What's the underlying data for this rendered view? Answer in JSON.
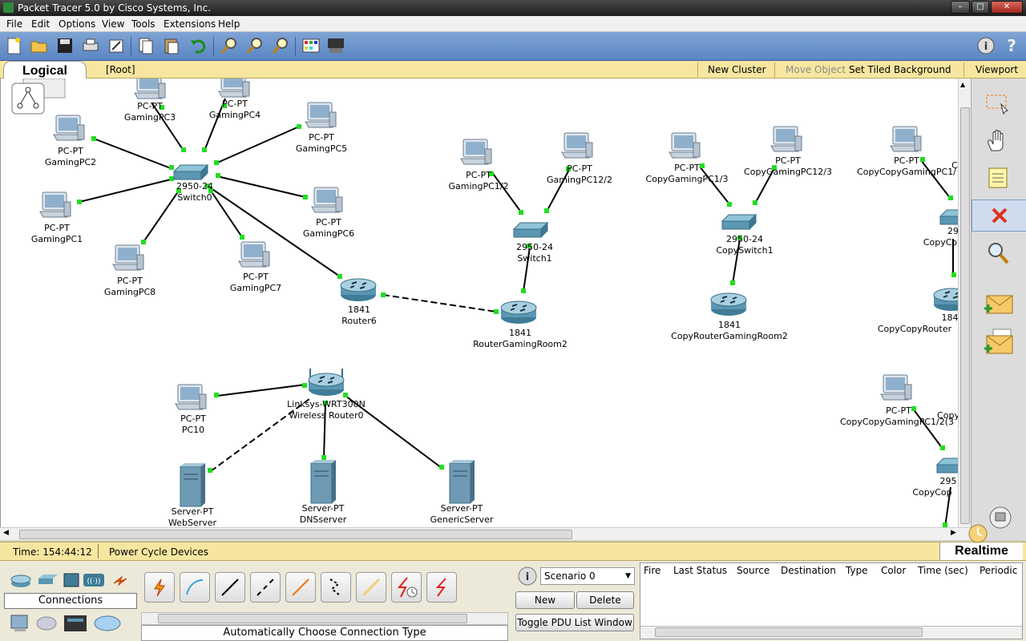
{
  "window": {
    "title": "Packet Tracer 5.0 by Cisco Systems, Inc."
  },
  "menu": [
    "File",
    "Edit",
    "Options",
    "View",
    "Tools",
    "Extensions",
    "Help"
  ],
  "toolbar_icons": [
    "new-icon",
    "open-icon",
    "save-icon",
    "print-icon",
    "wizard-icon",
    "copy-icon",
    "paste-icon",
    "undo-icon",
    "zoom-in-icon",
    "zoom-reset-icon",
    "zoom-out-icon",
    "palette-icon",
    "custom-device-icon"
  ],
  "viewbar": {
    "tab": "Logical",
    "root": "[Root]",
    "new_cluster": "New Cluster",
    "move_object": "Move Object",
    "tiled_bg": "Set Tiled Background",
    "viewport": "Viewport"
  },
  "devices": {
    "gpc3": [
      "PC-PT",
      "GamingPC3"
    ],
    "gpc4": [
      "PC-PT",
      "GamingPC4"
    ],
    "gpc2": [
      "PC-PT",
      "GamingPC2"
    ],
    "gpc5": [
      "PC-PT",
      "GamingPC5"
    ],
    "sw0": [
      "2950-24",
      "Switch0"
    ],
    "gpc1": [
      "PC-PT",
      "GamingPC1"
    ],
    "gpc6": [
      "PC-PT",
      "GamingPC6"
    ],
    "gpc8": [
      "PC-PT",
      "GamingPC8"
    ],
    "gpc7": [
      "PC-PT",
      "GamingPC7"
    ],
    "r6": [
      "1841",
      "Router6"
    ],
    "gpc12": [
      "PC-PT",
      "GamingPC1/2"
    ],
    "gpc122": [
      "PC-PT",
      "GamingPC12/2"
    ],
    "sw1": [
      "2950-24",
      "Switch1"
    ],
    "rgr2": [
      "1841",
      "RouterGamingRoom2"
    ],
    "cgpc13": [
      "PC-PT",
      "CopyGamingPC1/3"
    ],
    "cgpc123": [
      "PC-PT",
      "CopyGamingPC12/3"
    ],
    "csw1": [
      "2950-24",
      "CopySwitch1"
    ],
    "crgr2": [
      "1841",
      "CopyRouterGamingRoom2"
    ],
    "ccg1": [
      "PC-PT",
      "CopyCopyGamingPC1/"
    ],
    "ccsw": [
      "29",
      "CopyCo"
    ],
    "ccr": [
      "184",
      "CopyCopyRouter"
    ],
    "ccg2": [
      "PC-PT",
      "CopyCopyGamingPC1/2(3"
    ],
    "ccsw2": [
      "295",
      "CopyCop"
    ],
    "pc10": [
      "PC-PT",
      "PC10"
    ],
    "wr0": [
      "Linksys-WRT300N",
      "Wireless Router0"
    ],
    "web": [
      "Server-PT",
      "WebServer"
    ],
    "dns": [
      "Server-PT",
      "DNSserver"
    ],
    "gen": [
      "Server-PT",
      "GenericServer"
    ]
  },
  "edge_text": {
    "c1": "C",
    "c2": "Copy"
  },
  "status": {
    "time": "Time: 154:44:12",
    "power": "Power Cycle Devices",
    "mode": "Realtime"
  },
  "bottom": {
    "connections": "Connections",
    "auto_type": "Automatically Choose Connection Type",
    "scenario": "Scenario 0",
    "new": "New",
    "delete": "Delete",
    "toggle": "Toggle PDU List Window",
    "columns": [
      "Fire",
      "Last Status",
      "Source",
      "Destination",
      "Type",
      "Color",
      "Time (sec)",
      "Periodic"
    ]
  },
  "colors": {
    "toolbar": "#5a86c4",
    "yellowbar": "#f6e6a0",
    "port": "#22dd22"
  }
}
